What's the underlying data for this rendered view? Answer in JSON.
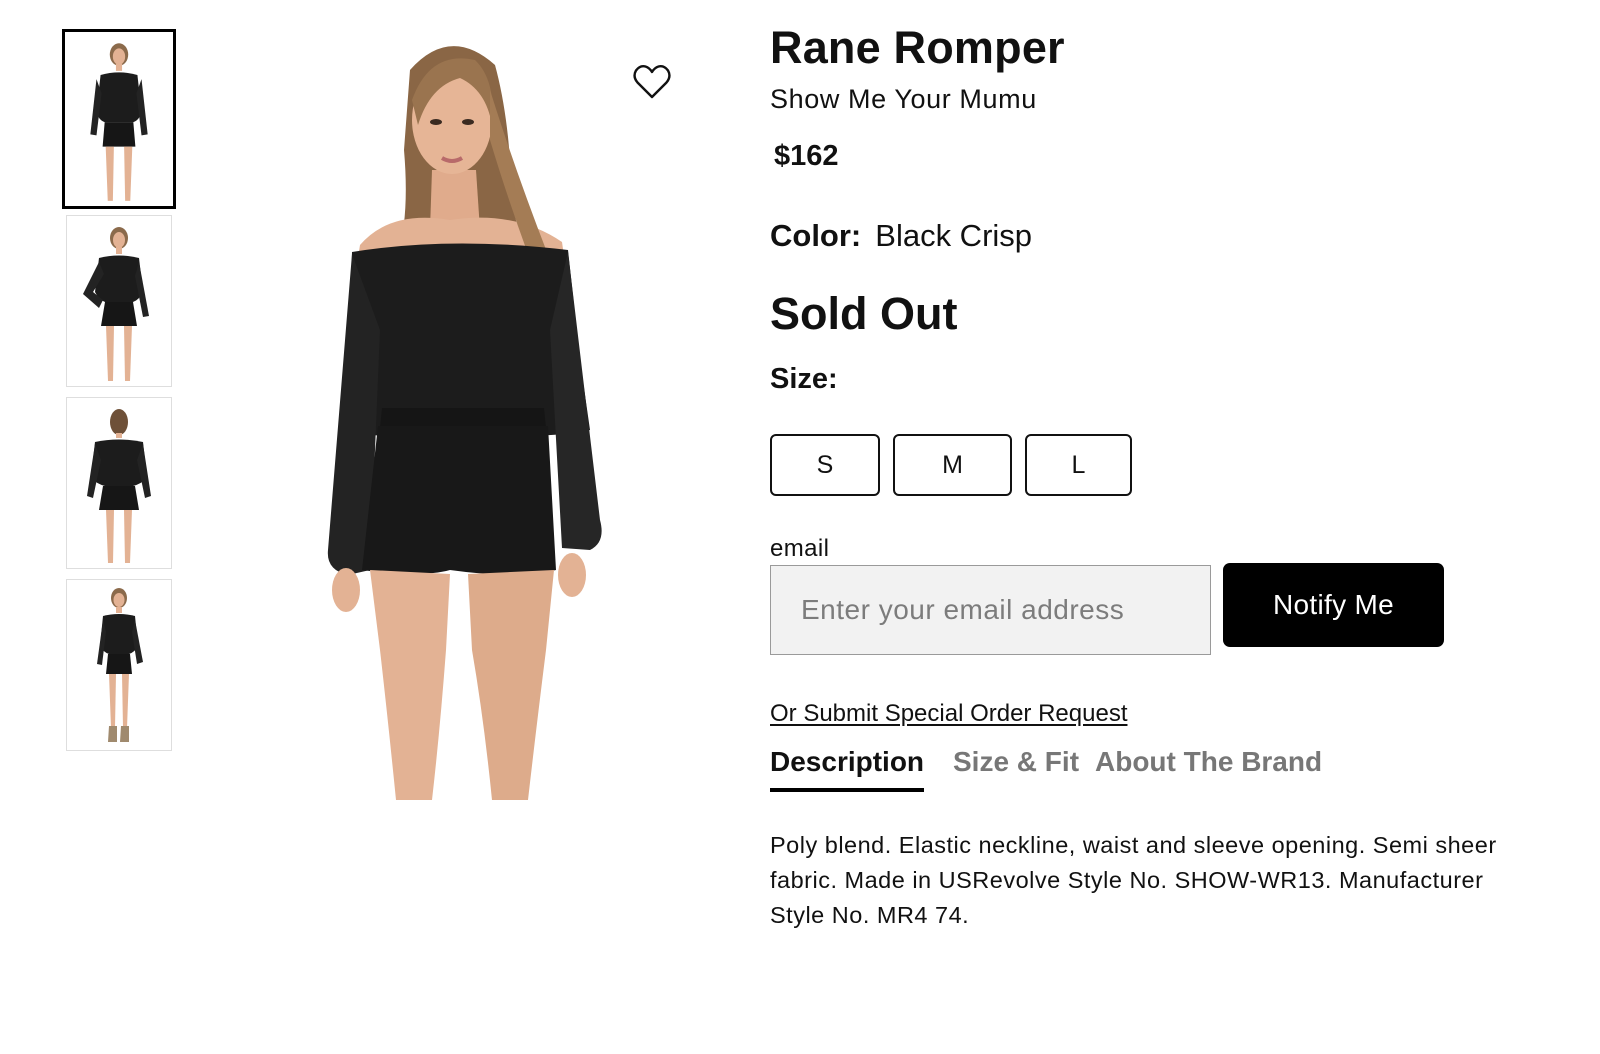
{
  "gallery": {
    "thumbnails": [
      {
        "view": "front",
        "selected": true
      },
      {
        "view": "front-hand-on-hip",
        "selected": false
      },
      {
        "view": "back",
        "selected": false
      },
      {
        "view": "full-length",
        "selected": false
      }
    ],
    "wishlist_icon": "heart-outline-icon"
  },
  "product": {
    "title": "Rane Romper",
    "brand": "Show Me Your Mumu",
    "price": "$162",
    "color_label": "Color:",
    "color_value": "Black Crisp",
    "availability": "Sold Out",
    "size_label": "Size:",
    "sizes": [
      "S",
      "M",
      "L"
    ]
  },
  "notify": {
    "email_label": "email",
    "email_placeholder": "Enter your email address",
    "email_value": "",
    "button_label": "Notify Me"
  },
  "special_order_link": "Or Submit Special Order Request",
  "tabs": [
    {
      "label": "Description",
      "active": true
    },
    {
      "label": "Size & Fit",
      "active": false
    },
    {
      "label": "About The Brand",
      "active": false
    }
  ],
  "description": "Poly blend. Elastic neckline, waist and sleeve opening. Semi sheer fabric. Made in USRevolve Style No. SHOW-WR13. Manufacturer Style No. MR4 74.",
  "colors": {
    "accent": "#000000",
    "inactive_tab": "#777777",
    "input_bg": "#f2f2f2",
    "garment": "#1a1a1a",
    "skin": "#e3b294"
  }
}
